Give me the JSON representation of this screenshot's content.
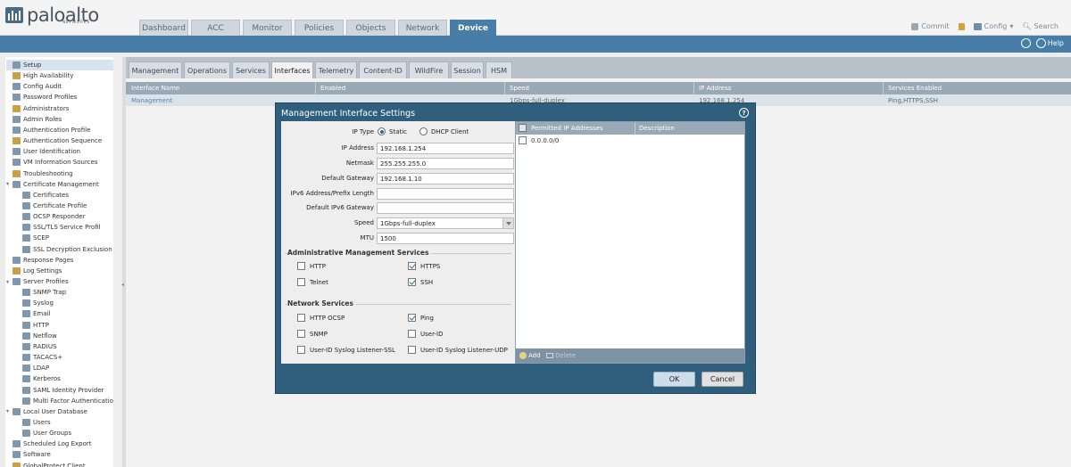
{
  "brand": {
    "name": "paloalto",
    "sub": "NETWORKS"
  },
  "nav": {
    "tabs": [
      {
        "label": "Dashboard"
      },
      {
        "label": "ACC"
      },
      {
        "label": "Monitor"
      },
      {
        "label": "Policies"
      },
      {
        "label": "Objects"
      },
      {
        "label": "Network"
      },
      {
        "label": "Device"
      }
    ],
    "active": "Device"
  },
  "header_actions": {
    "commit": "Commit",
    "config": "Config",
    "search": "Search"
  },
  "subbar": {
    "help": "Help"
  },
  "sidebar": {
    "items": [
      {
        "label": "Setup",
        "level": 0,
        "selected": true
      },
      {
        "label": "High Availability",
        "level": 0
      },
      {
        "label": "Config Audit",
        "level": 0
      },
      {
        "label": "Password Profiles",
        "level": 0
      },
      {
        "label": "Administrators",
        "level": 0
      },
      {
        "label": "Admin Roles",
        "level": 0
      },
      {
        "label": "Authentication Profile",
        "level": 0
      },
      {
        "label": "Authentication Sequence",
        "level": 0
      },
      {
        "label": "User Identification",
        "level": 0
      },
      {
        "label": "VM Information Sources",
        "level": 0
      },
      {
        "label": "Troubleshooting",
        "level": 0
      },
      {
        "label": "Certificate Management",
        "level": 0,
        "expanded": true
      },
      {
        "label": "Certificates",
        "level": 1
      },
      {
        "label": "Certificate Profile",
        "level": 1
      },
      {
        "label": "OCSP Responder",
        "level": 1
      },
      {
        "label": "SSL/TLS Service Profil",
        "level": 1
      },
      {
        "label": "SCEP",
        "level": 1
      },
      {
        "label": "SSL Decryption Exclusion",
        "level": 1
      },
      {
        "label": "Response Pages",
        "level": 0
      },
      {
        "label": "Log Settings",
        "level": 0
      },
      {
        "label": "Server Profiles",
        "level": 0,
        "expanded": true
      },
      {
        "label": "SNMP Trap",
        "level": 1
      },
      {
        "label": "Syslog",
        "level": 1
      },
      {
        "label": "Email",
        "level": 1
      },
      {
        "label": "HTTP",
        "level": 1
      },
      {
        "label": "Netflow",
        "level": 1
      },
      {
        "label": "RADIUS",
        "level": 1
      },
      {
        "label": "TACACS+",
        "level": 1
      },
      {
        "label": "LDAP",
        "level": 1
      },
      {
        "label": "Kerberos",
        "level": 1
      },
      {
        "label": "SAML Identity Provider",
        "level": 1
      },
      {
        "label": "Multi Factor Authenticatio",
        "level": 1
      },
      {
        "label": "Local User Database",
        "level": 0,
        "expanded": true
      },
      {
        "label": "Users",
        "level": 1
      },
      {
        "label": "User Groups",
        "level": 1
      },
      {
        "label": "Scheduled Log Export",
        "level": 0
      },
      {
        "label": "Software",
        "level": 0
      },
      {
        "label": "GlobalProtect Client",
        "level": 0
      }
    ]
  },
  "subtabs": [
    {
      "label": "Management"
    },
    {
      "label": "Operations"
    },
    {
      "label": "Services"
    },
    {
      "label": "Interfaces"
    },
    {
      "label": "Telemetry"
    },
    {
      "label": "Content-ID"
    },
    {
      "label": "WildFire"
    },
    {
      "label": "Session"
    },
    {
      "label": "HSM"
    }
  ],
  "active_subtab": "Interfaces",
  "grid": {
    "columns": [
      "Interface Name",
      "Enabled",
      "Speed",
      "IP Address",
      "Services Enabled"
    ],
    "row": [
      "Management",
      "",
      "1Gbps-full-duplex",
      "192.168.1.254",
      "Ping,HTTPS,SSH"
    ]
  },
  "modal": {
    "title": "Management Interface Settings",
    "ip_type_label": "IP Type",
    "ip_type_options": [
      "Static",
      "DHCP Client"
    ],
    "ip_type_selected": "Static",
    "fields": [
      {
        "label": "IP Address",
        "value": "192.168.1.254"
      },
      {
        "label": "Netmask",
        "value": "255.255.255.0"
      },
      {
        "label": "Default Gateway",
        "value": "192.168.1.10"
      },
      {
        "label": "IPv6 Address/Prefix Length",
        "value": ""
      },
      {
        "label": "Default IPv6 Gateway",
        "value": ""
      },
      {
        "label": "Speed",
        "value": "1Gbps-full-duplex"
      },
      {
        "label": "MTU",
        "value": "1500"
      }
    ],
    "admin_services": {
      "title": "Administrative Management Services",
      "items": [
        {
          "label": "HTTP",
          "checked": false
        },
        {
          "label": "HTTPS",
          "checked": true
        },
        {
          "label": "Telnet",
          "checked": false
        },
        {
          "label": "SSH",
          "checked": true
        }
      ]
    },
    "network_services": {
      "title": "Network Services",
      "items": [
        {
          "label": "HTTP OCSP",
          "checked": false
        },
        {
          "label": "Ping",
          "checked": true
        },
        {
          "label": "SNMP",
          "checked": false
        },
        {
          "label": "User-ID",
          "checked": false
        },
        {
          "label": "User-ID Syslog Listener-SSL",
          "checked": false
        },
        {
          "label": "User-ID Syslog Listener-UDP",
          "checked": false
        }
      ]
    },
    "permitted": {
      "columns": [
        "Permitted IP Addresses",
        "Description"
      ],
      "rows": [
        {
          "ip": "0.0.0.0/0",
          "description": ""
        }
      ],
      "add_label": "Add",
      "delete_label": "Delete"
    },
    "ok_label": "OK",
    "cancel_label": "Cancel"
  }
}
